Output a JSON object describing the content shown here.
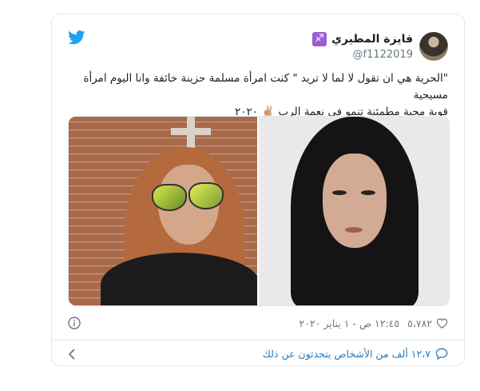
{
  "author": {
    "name": "فايزة المطيري",
    "handle": "@f1122019",
    "zodiac_symbol": "♐"
  },
  "tweet": {
    "text_line1": "\"الحرية هي ان تقول لا لما لا تريد \" كنت امرأة مسلمة حزينة خائفة وانا اليوم امرأة مسيحية",
    "text_line2": "قوية محبة مطمئنة تنمو في نعمة الرب ✌🏼 ٢٠٢٠"
  },
  "meta": {
    "likes": "٥،٧٨٢",
    "timestamp": "١٢:٤٥ ص - ١ يناير ٢٠٢٠"
  },
  "footer": {
    "conversation_text": "١٢،٧ ألف من الأشخاص يتحدثون عن ذلك"
  },
  "colors": {
    "twitter_blue": "#1da1f2",
    "link_blue": "#2b7bb9",
    "muted": "#697882",
    "border": "#e1e8ed"
  },
  "icons": [
    "twitter-logo-icon",
    "info-icon",
    "heart-icon",
    "chevron-left-icon",
    "speech-bubble-icon"
  ]
}
